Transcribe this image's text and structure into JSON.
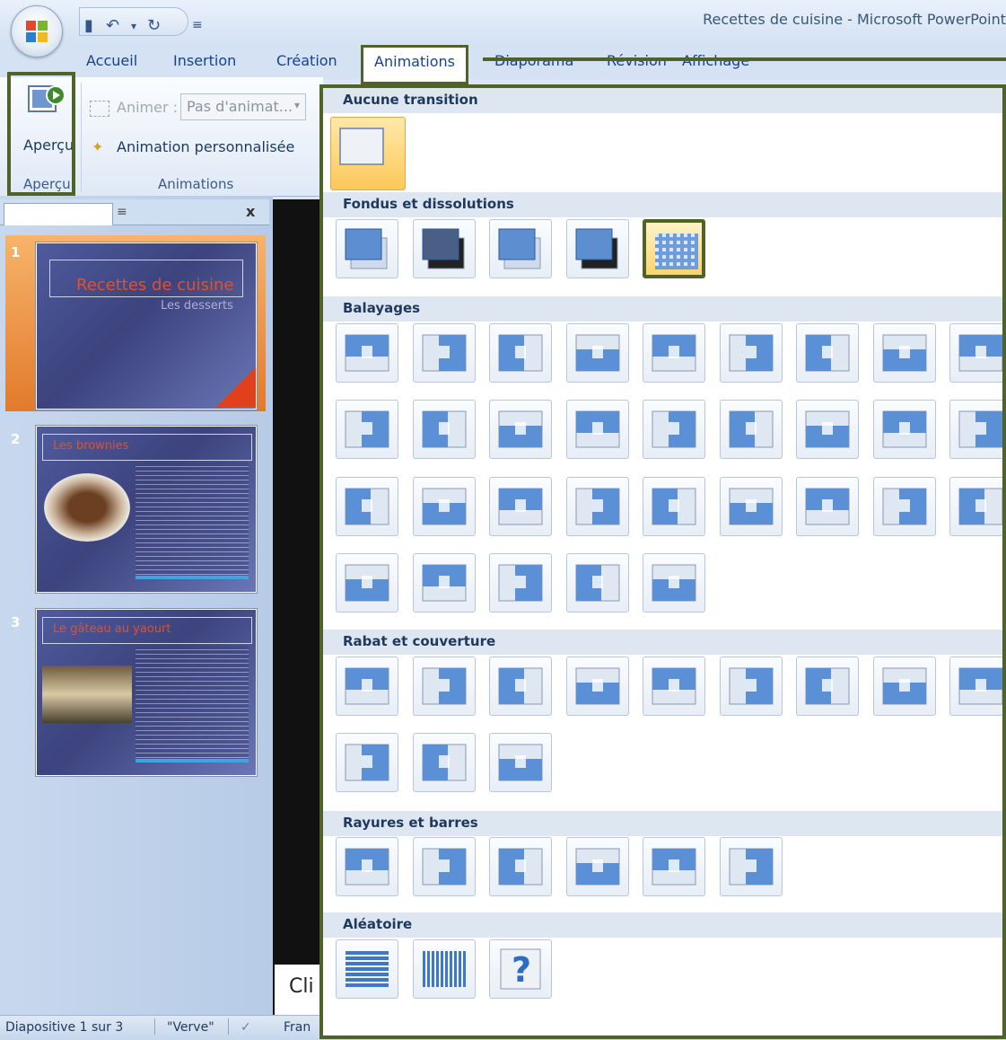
{
  "window": {
    "title": "Recettes de cuisine - Microsoft PowerPoint"
  },
  "tabs": [
    "Accueil",
    "Insertion",
    "Création",
    "Animations",
    "Diaporama",
    "Révision",
    "Affichage"
  ],
  "ribbon": {
    "apercu_button": "Aperçu",
    "apercu_group": "Aperçu",
    "animer_label": "Animer :",
    "animer_value": "Pas d'animat...",
    "custom_animation": "Animation personnalisée",
    "animations_group": "Animations"
  },
  "slides": [
    {
      "num": "1",
      "title": "Recettes de cuisine",
      "subtitle": "Les desserts"
    },
    {
      "num": "2",
      "title": "Les brownies"
    },
    {
      "num": "3",
      "title": "Le gâteau au yaourt"
    }
  ],
  "notes_text": "Cli",
  "gallery": {
    "sections": [
      {
        "name": "Aucune transition",
        "count": 1
      },
      {
        "name": "Fondus et dissolutions",
        "count": 5
      },
      {
        "name": "Balayages",
        "count": 32
      },
      {
        "name": "Rabat et couverture",
        "count": 12
      },
      {
        "name": "Rayures et barres",
        "count": 6
      },
      {
        "name": "Aléatoire",
        "count": 3
      }
    ]
  },
  "status": {
    "slide_info": "Diapositive 1 sur 3",
    "theme": "\"Verve\"",
    "language": "Fran"
  },
  "colors": {
    "callout": "#4f6228",
    "accent_orange": "#e27a2c",
    "ribbon_blue": "#15428b"
  }
}
